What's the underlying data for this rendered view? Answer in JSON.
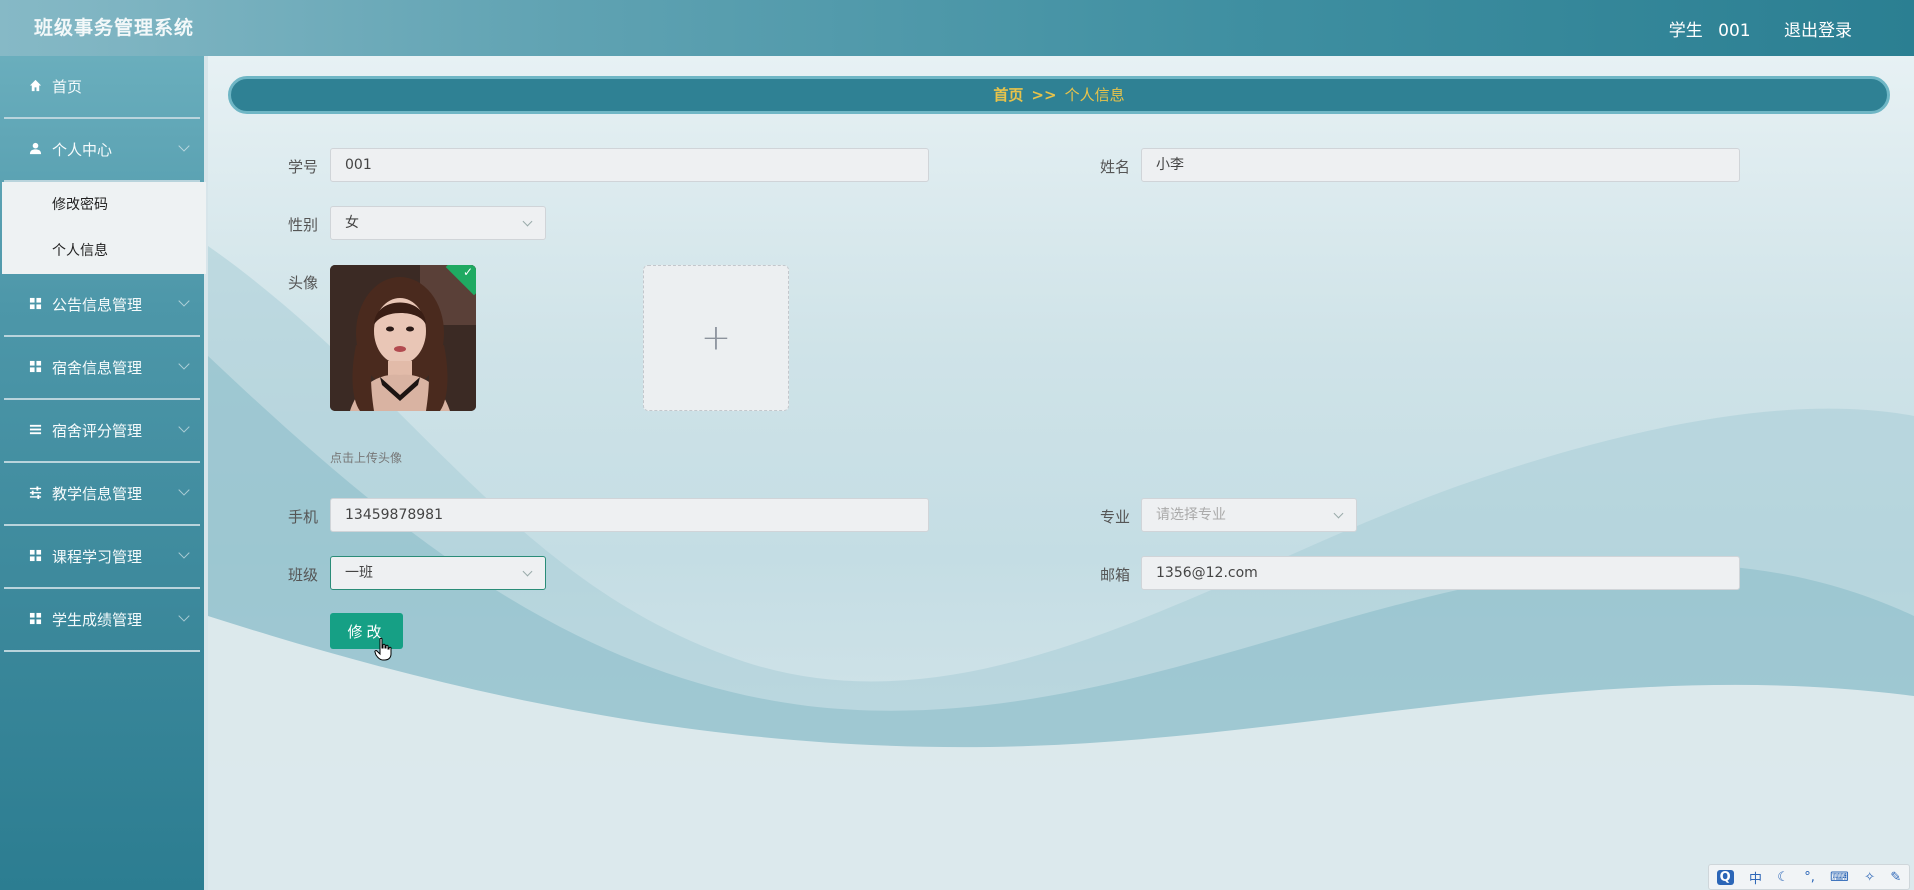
{
  "app": {
    "title": "班级事务管理系统"
  },
  "header": {
    "role": "学生",
    "user_id": "001",
    "logout": "退出登录"
  },
  "sidebar": {
    "items": [
      {
        "label": "首页",
        "icon": "home-icon"
      },
      {
        "label": "个人中心",
        "icon": "user-icon",
        "expanded": true,
        "children": [
          {
            "label": "修改密码"
          },
          {
            "label": "个人信息"
          }
        ]
      },
      {
        "label": "公告信息管理",
        "icon": "grid-icon"
      },
      {
        "label": "宿舍信息管理",
        "icon": "grid-icon"
      },
      {
        "label": "宿舍评分管理",
        "icon": "list-icon"
      },
      {
        "label": "教学信息管理",
        "icon": "sliders-icon"
      },
      {
        "label": "课程学习管理",
        "icon": "grid-icon"
      },
      {
        "label": "学生成绩管理",
        "icon": "grid-icon"
      }
    ]
  },
  "breadcrumb": {
    "home": "首页",
    "separator": ">>",
    "current": "个人信息"
  },
  "form": {
    "student_id": {
      "label": "学号",
      "value": "001"
    },
    "name": {
      "label": "姓名",
      "value": "小李"
    },
    "gender": {
      "label": "性别",
      "value": "女"
    },
    "avatar": {
      "label": "头像",
      "hint": "点击上传头像",
      "upload_symbol": "+"
    },
    "phone": {
      "label": "手机",
      "value": "13459878981"
    },
    "major": {
      "label": "专业",
      "placeholder": "请选择专业"
    },
    "class": {
      "label": "班级",
      "value": "一班"
    },
    "email": {
      "label": "邮箱",
      "value": "1356@12.com"
    },
    "submit_label": "修改"
  },
  "tray": {
    "ime": "中"
  },
  "colors": {
    "accent": "#16a085",
    "breadcrumb_bg": "#2f8194",
    "breadcrumb_text": "#e8c34a",
    "sidebar": "#3a879a"
  }
}
